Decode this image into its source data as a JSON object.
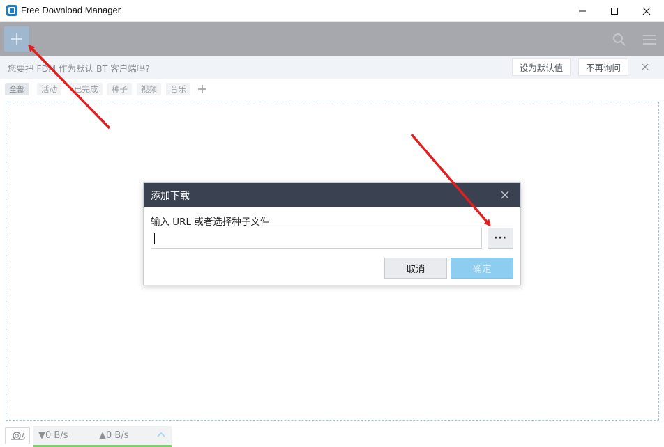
{
  "window": {
    "title": "Free Download Manager",
    "controls": [
      "minimize-icon",
      "maximize-icon",
      "close-icon"
    ]
  },
  "toolbar": {
    "add_icon": "plus-icon",
    "search_icon": "search-icon",
    "menu_icon": "hamburger-menu-icon"
  },
  "notice": {
    "text": "您要把 FDM 作为默认 BT 客户端吗?",
    "set_default_label": "设为默认值",
    "never_ask_label": "不再询问",
    "close_icon": "close-icon"
  },
  "filters": {
    "tabs": [
      "全部",
      "活动",
      "已完成",
      "种子",
      "视频",
      "音乐"
    ],
    "active_index": 0,
    "add_icon": "plus-icon"
  },
  "statusbar": {
    "snail_icon": "snail-icon",
    "download_speed": "▼0 B/s",
    "upload_speed": "▲0 B/s",
    "expand_icon": "chevron-up-icon"
  },
  "dialog": {
    "title": "添加下载",
    "label": "输入 URL 或者选择种子文件",
    "url_value": "",
    "browse_label": "···",
    "cancel_label": "取消",
    "ok_label": "确定"
  },
  "colors": {
    "toolbar_bg": "#a6a8ad",
    "dialog_header_bg": "#3a4150",
    "ok_button_bg": "#8ccdf0",
    "dropzone_border": "#9ac6e1",
    "annotation_arrow": "#e02020",
    "speed_underline": "#7bd16a"
  }
}
